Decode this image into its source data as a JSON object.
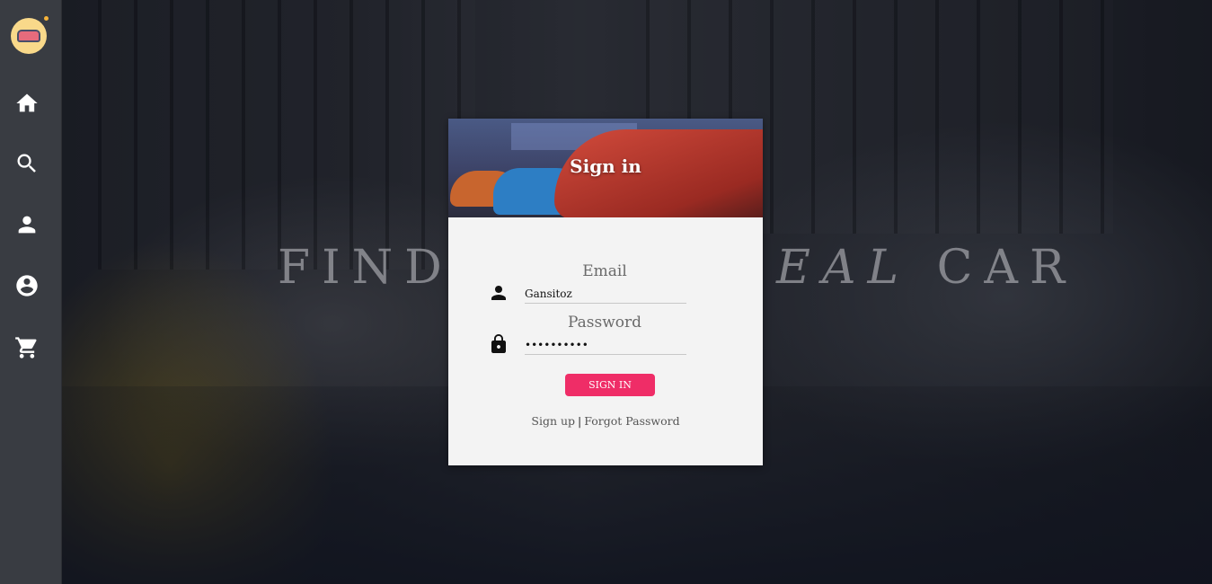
{
  "background": {
    "title_left": "FIND",
    "title_mid": "YOUR IDEAL",
    "title_right": "CAR"
  },
  "sidebar": {
    "logo": "car-logo",
    "items": [
      {
        "icon": "home-icon"
      },
      {
        "icon": "search-icon"
      },
      {
        "icon": "person-icon"
      },
      {
        "icon": "account-circle-icon"
      },
      {
        "icon": "cart-icon"
      }
    ]
  },
  "signin_card": {
    "title": "Sign in",
    "email": {
      "label": "Email",
      "value": "Gansitoz",
      "icon": "person-icon"
    },
    "password": {
      "label": "Password",
      "value": "••••••••••",
      "icon": "lock-icon"
    },
    "submit_label": "SIGN IN",
    "signup_link": "Sign up",
    "separator": "|",
    "forgot_link": "Forgot Password"
  },
  "colors": {
    "sidebar_bg": "#393c42",
    "accent": "#ef2d67",
    "card_bg": "#f3f3f3"
  }
}
